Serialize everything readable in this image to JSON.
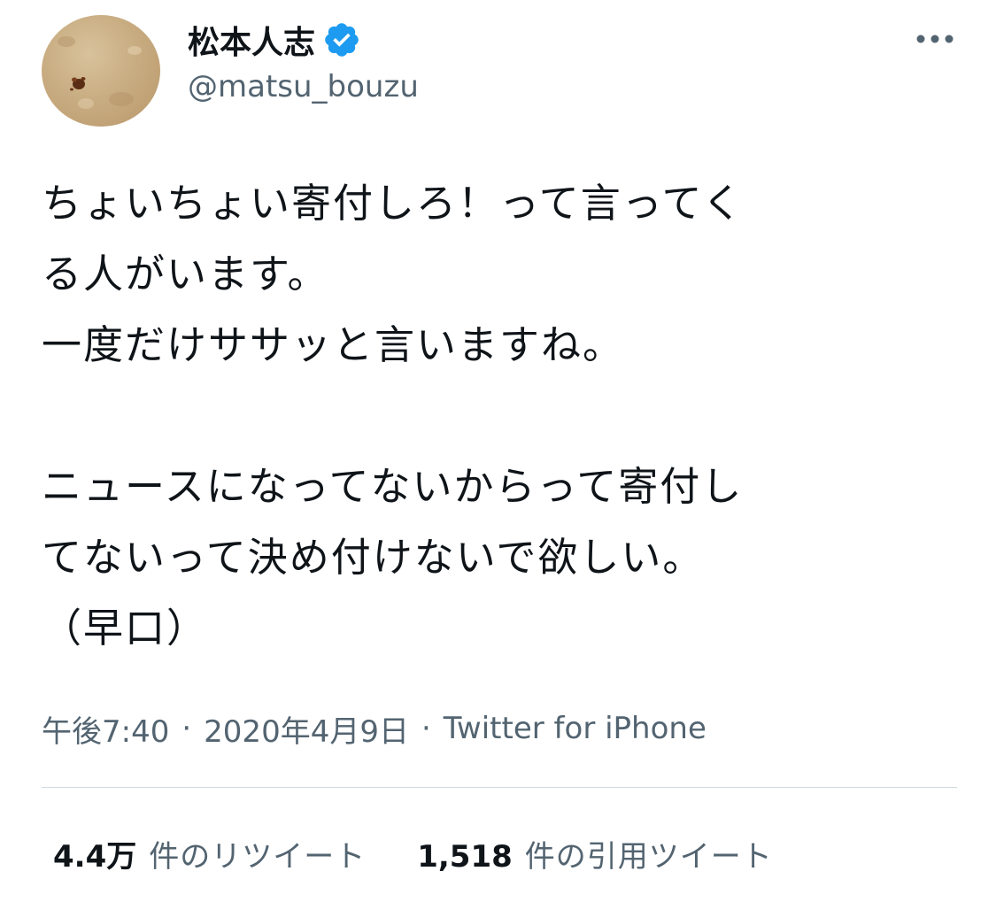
{
  "tweet": {
    "author": {
      "display_name": "松本人志",
      "handle": "@matsu_bouzu",
      "verified": true
    },
    "text": "ちょいちょい寄付しろ！って言ってく\nる人がいます。\n一度だけササッと言いますね。\n\nニュースになってないからって寄付し\nてないって決め付けないで欲しい。\n（早口）",
    "time": "午後7:40",
    "date": "2020年4月9日",
    "separator": "·",
    "source": "Twitter for iPhone",
    "stats": {
      "retweets_count": "4.4万",
      "retweets_label": "件のリツイート",
      "quotes_count": "1,518",
      "quotes_label": "件の引用ツイート"
    }
  },
  "colors": {
    "verified": "#1d9bf0",
    "secondary_text": "#536471",
    "primary_text": "#0f1419",
    "divider": "#cfd9de"
  },
  "icons": {
    "verified": "verified-badge-icon",
    "more": "more-horizontal-icon"
  }
}
